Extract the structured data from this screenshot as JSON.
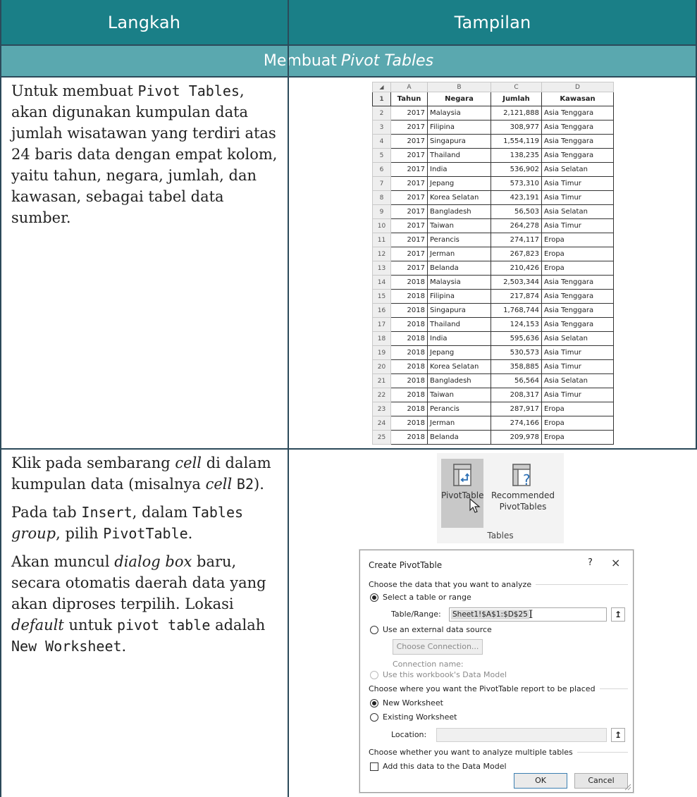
{
  "header": {
    "col_left": "Langkah",
    "col_right": "Tampilan"
  },
  "section": {
    "prefix": "Membuat",
    "italic": "Pivot Tables"
  },
  "row1": {
    "text_a": "Untuk membuat ",
    "code_a": "Pivot Tables",
    "text_b": ", akan digunakan kumpulan data jumlah wisatawan yang terdiri atas 24 baris data dengan empat kolom, yaitu tahun, negara, jumlah, dan kawasan, sebagai tabel data sumber."
  },
  "sheet": {
    "col_letters": [
      "A",
      "B",
      "C",
      "D"
    ],
    "headers": [
      "Tahun",
      "Negara",
      "Jumlah",
      "Kawasan"
    ],
    "rows": [
      [
        "2017",
        "Malaysia",
        "2,121,888",
        "Asia Tenggara"
      ],
      [
        "2017",
        "Filipina",
        "308,977",
        "Asia Tenggara"
      ],
      [
        "2017",
        "Singapura",
        "1,554,119",
        "Asia Tenggara"
      ],
      [
        "2017",
        "Thailand",
        "138,235",
        "Asia Tenggara"
      ],
      [
        "2017",
        "India",
        "536,902",
        "Asia Selatan"
      ],
      [
        "2017",
        "Jepang",
        "573,310",
        "Asia Timur"
      ],
      [
        "2017",
        "Korea Selatan",
        "423,191",
        "Asia Timur"
      ],
      [
        "2017",
        "Bangladesh",
        "56,503",
        "Asia Selatan"
      ],
      [
        "2017",
        "Taiwan",
        "264,278",
        "Asia Timur"
      ],
      [
        "2017",
        "Perancis",
        "274,117",
        "Eropa"
      ],
      [
        "2017",
        "Jerman",
        "267,823",
        "Eropa"
      ],
      [
        "2017",
        "Belanda",
        "210,426",
        "Eropa"
      ],
      [
        "2018",
        "Malaysia",
        "2,503,344",
        "Asia Tenggara"
      ],
      [
        "2018",
        "Filipina",
        "217,874",
        "Asia Tenggara"
      ],
      [
        "2018",
        "Singapura",
        "1,768,744",
        "Asia Tenggara"
      ],
      [
        "2018",
        "Thailand",
        "124,153",
        "Asia Tenggara"
      ],
      [
        "2018",
        "India",
        "595,636",
        "Asia Selatan"
      ],
      [
        "2018",
        "Jepang",
        "530,573",
        "Asia Timur"
      ],
      [
        "2018",
        "Korea Selatan",
        "358,885",
        "Asia Timur"
      ],
      [
        "2018",
        "Bangladesh",
        "56,564",
        "Asia Selatan"
      ],
      [
        "2018",
        "Taiwan",
        "208,317",
        "Asia Timur"
      ],
      [
        "2018",
        "Perancis",
        "287,917",
        "Eropa"
      ],
      [
        "2018",
        "Jerman",
        "274,166",
        "Eropa"
      ],
      [
        "2018",
        "Belanda",
        "209,978",
        "Eropa"
      ]
    ]
  },
  "row2": {
    "p1_a": "Klik pada sembarang ",
    "p1_italic": "cell",
    "p1_b": " di dalam kumpulan data (misalnya ",
    "p1_italic2": "cell",
    "p1_code": "B2",
    "p1_c": ").",
    "p2_a": "Pada tab ",
    "p2_code1": "Insert",
    "p2_b": ", dalam ",
    "p2_code2": "Tables",
    "p2_italic": "group",
    "p2_c": ", pilih ",
    "p2_code3": "PivotTable",
    "p2_d": ".",
    "p3_a": "Akan muncul ",
    "p3_italic": "dialog box",
    "p3_b": " baru, secara otomatis daerah data yang akan diproses terpilih. Lokasi ",
    "p3_italic2": "default",
    "p3_c": " untuk ",
    "p3_code1": "pivot table",
    "p3_d": " adalah ",
    "p3_code2": "New Worksheet",
    "p3_e": "."
  },
  "ribbon": {
    "btn1": "PivotTable",
    "btn2_line1": "Recommended",
    "btn2_line2": "PivotTables",
    "group": "Tables"
  },
  "dialog": {
    "title": "Create PivotTable",
    "help": "?",
    "close": "×",
    "sect1": "Choose the data that you want to analyze",
    "opt_select": "Select a table or range",
    "table_range_label": "Table/Range:",
    "table_range_value": "Sheet1!$A$1:$D$25",
    "opt_external": "Use an external data source",
    "choose_connection": "Choose Connection...",
    "connection_name": "Connection name:",
    "opt_workbook_model": "Use this workbook's Data Model",
    "sect2": "Choose where you want the PivotTable report to be placed",
    "opt_new": "New Worksheet",
    "opt_existing": "Existing Worksheet",
    "location_label": "Location:",
    "location_value": "",
    "sect3": "Choose whether you want to analyze multiple tables",
    "add_model": "Add this data to the Data Model",
    "ok": "OK",
    "cancel": "Cancel"
  },
  "colors": {
    "header_bg": "#1a7f87",
    "subheader_bg": "#5aa8af",
    "border": "#2c4a5a"
  }
}
